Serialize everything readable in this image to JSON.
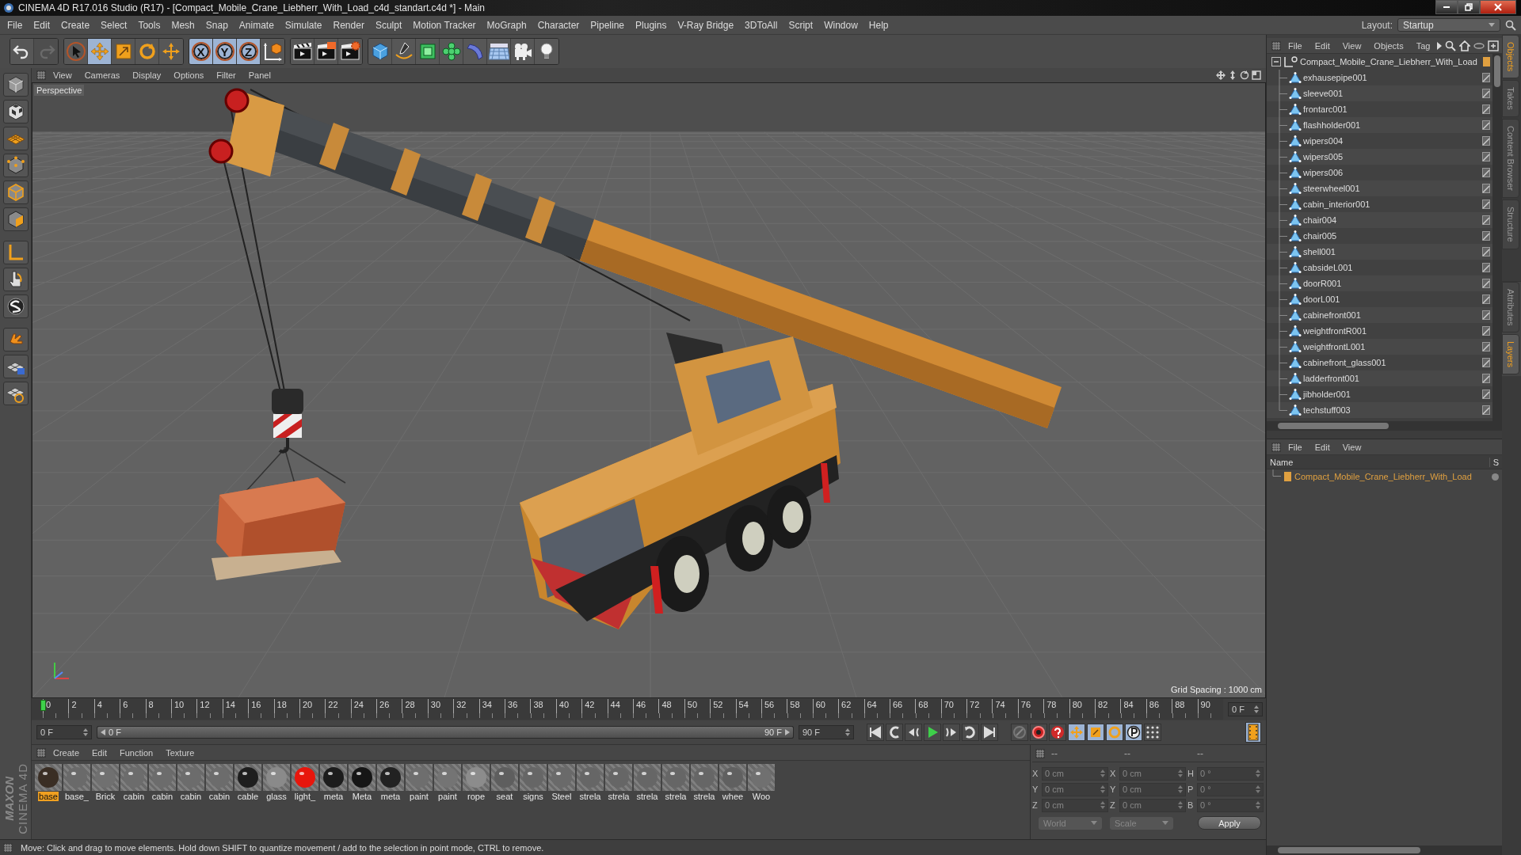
{
  "window": {
    "title": "CINEMA 4D R17.016 Studio (R17) - [Compact_Mobile_Crane_Liebherr_With_Load_c4d_standart.c4d *] - Main"
  },
  "menu": [
    "File",
    "Edit",
    "Create",
    "Select",
    "Tools",
    "Mesh",
    "Snap",
    "Animate",
    "Simulate",
    "Render",
    "Sculpt",
    "Motion Tracker",
    "MoGraph",
    "Character",
    "Pipeline",
    "Plugins",
    "V-Ray Bridge",
    "3DToAll",
    "Script",
    "Window",
    "Help"
  ],
  "layout": {
    "label": "Layout:",
    "value": "Startup"
  },
  "toolbar": [
    [
      {
        "selected": false,
        "disabled": false
      },
      {
        "selected": false,
        "disabled": true
      }
    ],
    [
      {
        "selected": false
      },
      {
        "selected": true
      },
      {
        "selected": false
      },
      {
        "selected": false
      },
      {
        "selected": false
      }
    ],
    [
      {
        "label": "X",
        "selected": true
      },
      {
        "label": "Y",
        "selected": true
      },
      {
        "label": "Z",
        "selected": true
      },
      {
        "selected": false
      }
    ],
    [
      {
        "selected": false
      },
      {
        "selected": false
      },
      {
        "selected": false
      }
    ],
    [
      {
        "selected": false
      },
      {
        "selected": false
      },
      {
        "selected": false
      },
      {
        "selected": false
      },
      {
        "selected": false
      },
      {
        "selected": false
      },
      {
        "selected": false
      },
      {
        "selected": false
      }
    ]
  ],
  "viewport": {
    "menu": [
      "View",
      "Cameras",
      "Display",
      "Options",
      "Filter",
      "Panel"
    ],
    "camera": "Perspective",
    "grid_spacing": "Grid Spacing : 1000 cm"
  },
  "timeline": {
    "ticks": [
      "0",
      "2",
      "4",
      "6",
      "8",
      "10",
      "12",
      "14",
      "16",
      "18",
      "20",
      "22",
      "24",
      "26",
      "28",
      "30",
      "32",
      "34",
      "36",
      "38",
      "40",
      "42",
      "44",
      "46",
      "48",
      "50",
      "52",
      "54",
      "56",
      "58",
      "60",
      "62",
      "64",
      "66",
      "68",
      "70",
      "72",
      "74",
      "76",
      "78",
      "80",
      "82",
      "84",
      "86",
      "88",
      "90"
    ],
    "current": "0 F"
  },
  "transport": {
    "level": 1,
    "start": "0 F",
    "range_start": "0 F",
    "range_end": "90 F",
    "end": "90 F"
  },
  "materials": {
    "menu": [
      "Create",
      "Edit",
      "Function",
      "Texture"
    ],
    "items": [
      {
        "name": "base",
        "selected": true,
        "color": "#3a2e24"
      },
      {
        "name": "base_",
        "selected": false,
        "color": "#6a6a6a"
      },
      {
        "name": "Brick",
        "selected": false,
        "color": "#707070"
      },
      {
        "name": "cabin",
        "selected": false,
        "color": "#6c6c6c"
      },
      {
        "name": "cabin",
        "selected": false,
        "color": "#6c6c6c"
      },
      {
        "name": "cabin",
        "selected": false,
        "color": "#6c6c6c"
      },
      {
        "name": "cabin",
        "selected": false,
        "color": "#6c6c6c"
      },
      {
        "name": "cable",
        "selected": false,
        "color": "#1e1e1e"
      },
      {
        "name": "glass",
        "selected": false,
        "color": "#8a8a8a"
      },
      {
        "name": "light_",
        "selected": false,
        "color": "#e8160c"
      },
      {
        "name": "meta",
        "selected": false,
        "color": "#1c1c1c"
      },
      {
        "name": "Meta",
        "selected": false,
        "color": "#161616"
      },
      {
        "name": "meta",
        "selected": false,
        "color": "#222222"
      },
      {
        "name": "paint",
        "selected": false,
        "color": "#6e6e6e"
      },
      {
        "name": "paint",
        "selected": false,
        "color": "#747474"
      },
      {
        "name": "rope",
        "selected": false,
        "color": "#8c8c8c"
      },
      {
        "name": "seat",
        "selected": false,
        "color": "#5e5e5e"
      },
      {
        "name": "signs",
        "selected": false,
        "color": "#666666"
      },
      {
        "name": "Steel",
        "selected": false,
        "color": "#6a6a6a"
      },
      {
        "name": "strela",
        "selected": false,
        "color": "#666666"
      },
      {
        "name": "strela",
        "selected": false,
        "color": "#666666"
      },
      {
        "name": "strela",
        "selected": false,
        "color": "#666666"
      },
      {
        "name": "strela",
        "selected": false,
        "color": "#666666"
      },
      {
        "name": "strela",
        "selected": false,
        "color": "#666666"
      },
      {
        "name": "whee",
        "selected": false,
        "color": "#606060"
      },
      {
        "name": "Woo",
        "selected": false,
        "color": "#707070"
      }
    ]
  },
  "coordinates": {
    "headers": [
      "--",
      "--",
      "--"
    ],
    "rows": [
      [
        {
          "axis": "X",
          "value": "0 cm"
        },
        {
          "axis": "X",
          "value": "0 cm"
        },
        {
          "axis": "H",
          "value": "0 °"
        }
      ],
      [
        {
          "axis": "Y",
          "value": "0 cm"
        },
        {
          "axis": "Y",
          "value": "0 cm"
        },
        {
          "axis": "P",
          "value": "0 °"
        }
      ],
      [
        {
          "axis": "Z",
          "value": "0 cm"
        },
        {
          "axis": "Z",
          "value": "0 cm"
        },
        {
          "axis": "B",
          "value": "0 °"
        }
      ]
    ],
    "space": "World",
    "mode": "Scale",
    "apply": "Apply"
  },
  "status_bar": "Move: Click and drag to move elements. Hold down SHIFT to quantize movement / add to the selection in point mode, CTRL to remove.",
  "logo": {
    "brand": "MAXON",
    "product": "CINEMA 4D"
  },
  "objects": {
    "menu": [
      "File",
      "Edit",
      "View",
      "Objects",
      "Tag"
    ],
    "root": {
      "name": "Compact_Mobile_Crane_Liebherr_With_Load",
      "expanded": true,
      "color": "#e0a040",
      "children": [
        {
          "name": "exhausepipe001"
        },
        {
          "name": "sleeve001"
        },
        {
          "name": "frontarc001"
        },
        {
          "name": "flashholder001"
        },
        {
          "name": "wipers004"
        },
        {
          "name": "wipers005"
        },
        {
          "name": "wipers006"
        },
        {
          "name": "steerwheel001"
        },
        {
          "name": "cabin_interior001"
        },
        {
          "name": "chair004"
        },
        {
          "name": "chair005"
        },
        {
          "name": "shell001"
        },
        {
          "name": "cabsideL001"
        },
        {
          "name": "doorR001"
        },
        {
          "name": "doorL001"
        },
        {
          "name": "cabinefront001"
        },
        {
          "name": "weightfrontR001"
        },
        {
          "name": "weightfrontL001"
        },
        {
          "name": "cabinefront_glass001"
        },
        {
          "name": "ladderfront001"
        },
        {
          "name": "jibholder001"
        },
        {
          "name": "techstuff003"
        }
      ]
    }
  },
  "layers": {
    "menu": [
      "File",
      "Edit",
      "View"
    ],
    "columns": [
      "Name",
      "S"
    ],
    "rows": [
      {
        "name": "Compact_Mobile_Crane_Liebherr_With_Load",
        "color": "#e0a040"
      }
    ]
  },
  "side_tabs": {
    "top": [
      {
        "label": "Objects",
        "selected": true
      },
      {
        "label": "Takes",
        "selected": false
      },
      {
        "label": "Content Browser",
        "selected": false
      },
      {
        "label": "Structure",
        "selected": false
      }
    ],
    "bottom": [
      {
        "label": "Attributes",
        "selected": false
      },
      {
        "label": "Layers",
        "selected": true
      }
    ]
  }
}
